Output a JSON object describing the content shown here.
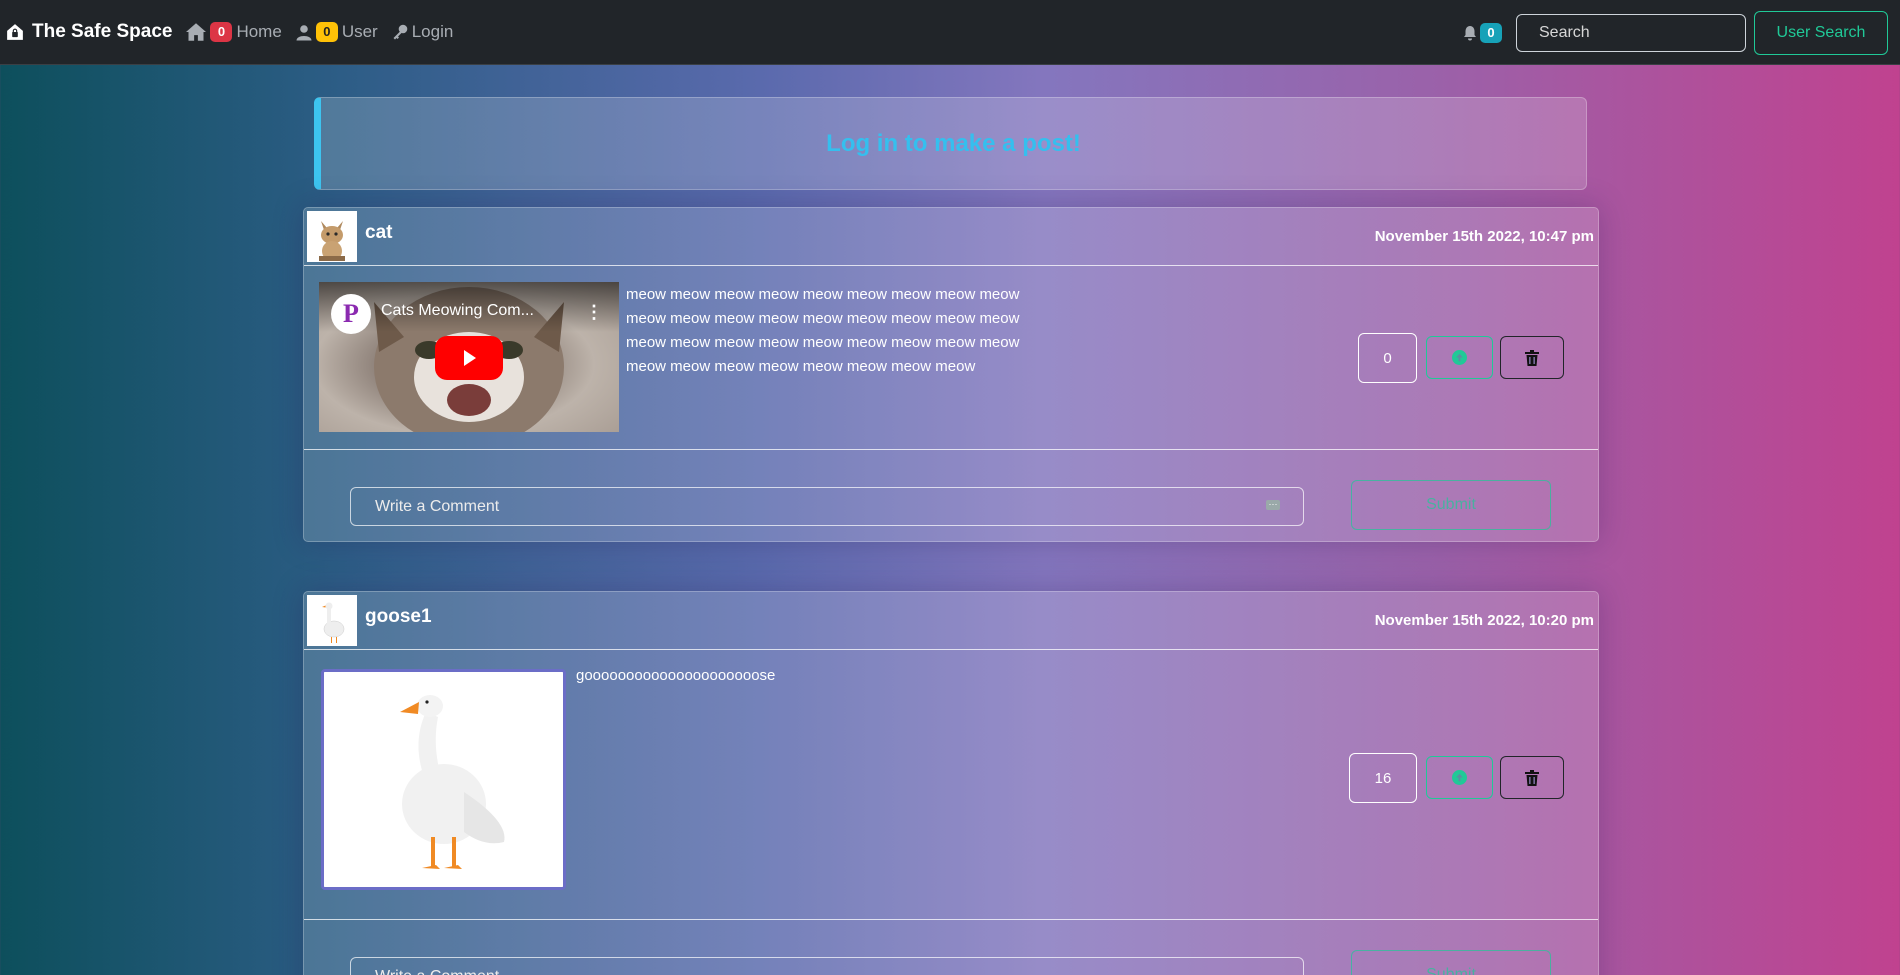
{
  "navbar": {
    "brand": "The Safe Space",
    "home": {
      "badge": "0",
      "label": "Home"
    },
    "user": {
      "badge": "0",
      "label": "User"
    },
    "login": {
      "label": "Login"
    },
    "notifications": {
      "badge": "0"
    },
    "search": {
      "placeholder": "Search"
    },
    "user_search_label": "User Search"
  },
  "alert": {
    "text": "Log in to make a post!"
  },
  "posts": [
    {
      "username": "cat",
      "date": "November 15th 2022, 10:47 pm",
      "video": {
        "title": "Cats Meowing Com...",
        "channel_initial": "P"
      },
      "text": "meow meow meow meow meow meow meow meow meow meow meow meow meow meow meow meow meow meow meow meow meow meow meow meow meow meow meow meow meow meow meow meow meow meow meow",
      "votes": "0",
      "comment_placeholder": "Write a Comment",
      "submit_label": "Submit"
    },
    {
      "username": "goose1",
      "date": "November 15th 2022, 10:20 pm",
      "text": "gooooooooooooooooooooose",
      "votes": "16",
      "comment_placeholder": "Write a Comment",
      "submit_label": "Submit"
    }
  ],
  "colors": {
    "accent": "#20c997",
    "info": "#35bfee",
    "danger": "#dc3545",
    "warning": "#ffc107"
  }
}
